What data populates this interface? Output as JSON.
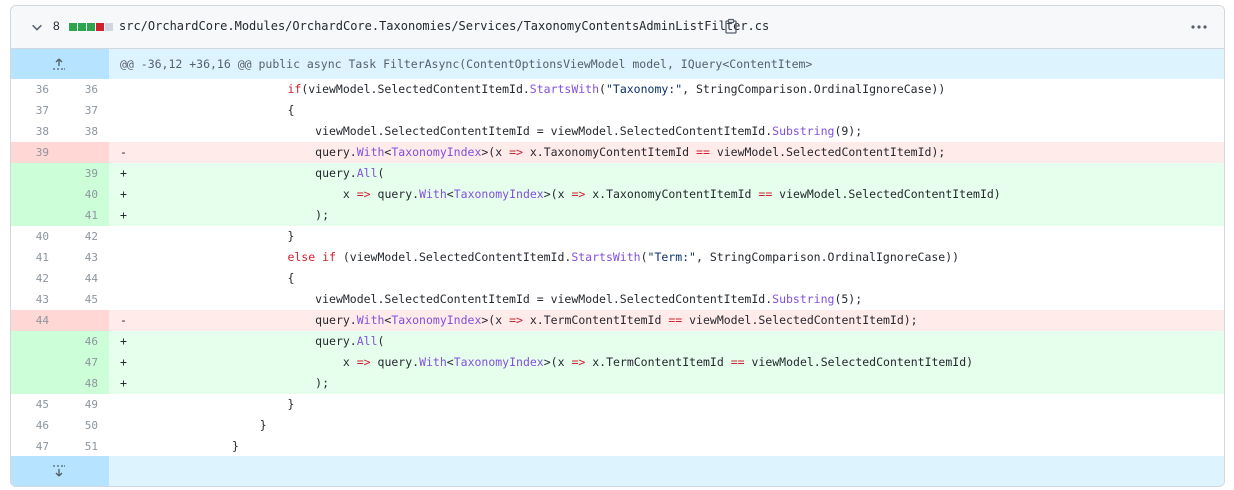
{
  "file": {
    "changes": "8",
    "diffstat": [
      "#2da44e",
      "#2da44e",
      "#2da44e",
      "#cf222e",
      "#d0d7de"
    ],
    "path": "src/OrchardCore.Modules/OrchardCore.Taxonomies/Services/TaxonomyContentsAdminListFilter.cs"
  },
  "hunk": "@@ -36,12 +36,16 @@ public async Task FilterAsync(ContentOptionsViewModel model, IQuery<ContentItem>",
  "lines": [
    {
      "t": "ctx",
      "o": "36",
      "n": "36",
      "s": "",
      "i": 22,
      "p": [
        [
          "kw",
          "if"
        ],
        [
          "",
          "(viewModel.SelectedContentItemId."
        ],
        [
          "fn",
          "StartsWith"
        ],
        [
          "",
          "("
        ],
        [
          "st",
          "\"Taxonomy:\""
        ],
        [
          "",
          ", StringComparison.OrdinalIgnoreCase))"
        ]
      ]
    },
    {
      "t": "ctx",
      "o": "37",
      "n": "37",
      "s": "",
      "i": 22,
      "p": [
        [
          "",
          "{"
        ]
      ]
    },
    {
      "t": "ctx",
      "o": "38",
      "n": "38",
      "s": "",
      "i": 26,
      "p": [
        [
          "",
          "viewModel.SelectedContentItemId = viewModel.SelectedContentItemId."
        ],
        [
          "fn",
          "Substring"
        ],
        [
          "",
          "(9);"
        ]
      ]
    },
    {
      "t": "del",
      "o": "39",
      "n": "",
      "s": "-",
      "i": 26,
      "p": [
        [
          "",
          "query."
        ],
        [
          "fn",
          "With"
        ],
        [
          "",
          "<"
        ],
        [
          "fn",
          "TaxonomyIndex"
        ],
        [
          "",
          ">(x "
        ],
        [
          "op",
          "=>"
        ],
        [
          "",
          " x.TaxonomyContentItemId "
        ],
        [
          "op",
          "=="
        ],
        [
          "",
          " viewModel.SelectedContentItemId);"
        ]
      ]
    },
    {
      "t": "add",
      "o": "",
      "n": "39",
      "s": "+",
      "i": 26,
      "p": [
        [
          "",
          "query."
        ],
        [
          "fn",
          "All"
        ],
        [
          "",
          "("
        ]
      ]
    },
    {
      "t": "add",
      "o": "",
      "n": "40",
      "s": "+",
      "i": 30,
      "p": [
        [
          "",
          "x "
        ],
        [
          "op",
          "=>"
        ],
        [
          "",
          " query."
        ],
        [
          "fn",
          "With"
        ],
        [
          "",
          "<"
        ],
        [
          "fn",
          "TaxonomyIndex"
        ],
        [
          "",
          ">(x "
        ],
        [
          "op",
          "=>"
        ],
        [
          "",
          " x.TaxonomyContentItemId "
        ],
        [
          "op",
          "=="
        ],
        [
          "",
          " viewModel.SelectedContentItemId)"
        ]
      ]
    },
    {
      "t": "add",
      "o": "",
      "n": "41",
      "s": "+",
      "i": 26,
      "p": [
        [
          "",
          ");"
        ]
      ]
    },
    {
      "t": "ctx",
      "o": "40",
      "n": "42",
      "s": "",
      "i": 22,
      "p": [
        [
          "",
          "}"
        ]
      ]
    },
    {
      "t": "ctx",
      "o": "41",
      "n": "43",
      "s": "",
      "i": 22,
      "p": [
        [
          "kw",
          "else if"
        ],
        [
          "",
          " (viewModel.SelectedContentItemId."
        ],
        [
          "fn",
          "StartsWith"
        ],
        [
          "",
          "("
        ],
        [
          "st",
          "\"Term:\""
        ],
        [
          "",
          ", StringComparison.OrdinalIgnoreCase))"
        ]
      ]
    },
    {
      "t": "ctx",
      "o": "42",
      "n": "44",
      "s": "",
      "i": 22,
      "p": [
        [
          "",
          "{"
        ]
      ]
    },
    {
      "t": "ctx",
      "o": "43",
      "n": "45",
      "s": "",
      "i": 26,
      "p": [
        [
          "",
          "viewModel.SelectedContentItemId = viewModel.SelectedContentItemId."
        ],
        [
          "fn",
          "Substring"
        ],
        [
          "",
          "(5);"
        ]
      ]
    },
    {
      "t": "del",
      "o": "44",
      "n": "",
      "s": "-",
      "i": 26,
      "p": [
        [
          "",
          "query."
        ],
        [
          "fn",
          "With"
        ],
        [
          "",
          "<"
        ],
        [
          "fn",
          "TaxonomyIndex"
        ],
        [
          "",
          ">(x "
        ],
        [
          "op",
          "=>"
        ],
        [
          "",
          " x.TermContentItemId "
        ],
        [
          "op",
          "=="
        ],
        [
          "",
          " viewModel.SelectedContentItemId);"
        ]
      ]
    },
    {
      "t": "add",
      "o": "",
      "n": "46",
      "s": "+",
      "i": 26,
      "p": [
        [
          "",
          "query."
        ],
        [
          "fn",
          "All"
        ],
        [
          "",
          "("
        ]
      ]
    },
    {
      "t": "add",
      "o": "",
      "n": "47",
      "s": "+",
      "i": 30,
      "p": [
        [
          "",
          "x "
        ],
        [
          "op",
          "=>"
        ],
        [
          "",
          " query."
        ],
        [
          "fn",
          "With"
        ],
        [
          "",
          "<"
        ],
        [
          "fn",
          "TaxonomyIndex"
        ],
        [
          "",
          ">(x "
        ],
        [
          "op",
          "=>"
        ],
        [
          "",
          " x.TermContentItemId "
        ],
        [
          "op",
          "=="
        ],
        [
          "",
          " viewModel.SelectedContentItemId)"
        ]
      ]
    },
    {
      "t": "add",
      "o": "",
      "n": "48",
      "s": "+",
      "i": 26,
      "p": [
        [
          "",
          ");"
        ]
      ]
    },
    {
      "t": "ctx",
      "o": "45",
      "n": "49",
      "s": "",
      "i": 22,
      "p": [
        [
          "",
          "}"
        ]
      ]
    },
    {
      "t": "ctx",
      "o": "46",
      "n": "50",
      "s": "",
      "i": 18,
      "p": [
        [
          "",
          "}"
        ]
      ]
    },
    {
      "t": "ctx",
      "o": "47",
      "n": "51",
      "s": "",
      "i": 14,
      "p": [
        [
          "",
          "}"
        ]
      ]
    }
  ]
}
